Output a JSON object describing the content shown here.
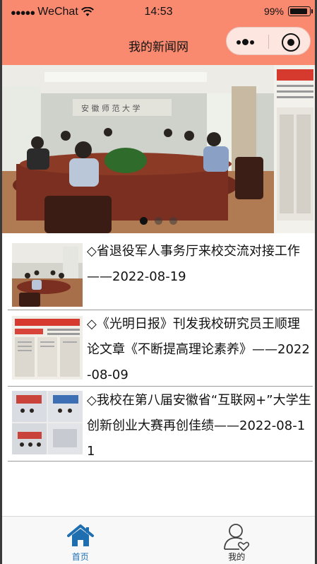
{
  "status_bar": {
    "signal_dots": "●●●●●",
    "carrier": "WeChat",
    "time": "14:53",
    "battery": "99%"
  },
  "nav": {
    "title": "我的新闻网",
    "capsule_icons": [
      "more-dots-icon",
      "close-target-icon"
    ]
  },
  "banner": {
    "slide_count": 3,
    "active_index": 0
  },
  "news": [
    {
      "title": "◇省退役军人事务厅来校交流对接工作——2022-08-19"
    },
    {
      "title": "◇《光明日报》刊发我校研究员王顺理论文章《不断提高理论素养》——2022-08-09"
    },
    {
      "title": "◇我校在第八届安徽省“互联网+”大学生创新创业大赛再创佳绩——2022-08-11"
    }
  ],
  "tabbar": {
    "tabs": [
      {
        "label": "首页",
        "icon": "home-icon",
        "active": true
      },
      {
        "label": "我的",
        "icon": "user-icon",
        "active": false
      }
    ],
    "active_color": "#1f6fb0"
  },
  "colors": {
    "brand": "#fa8a6f"
  }
}
